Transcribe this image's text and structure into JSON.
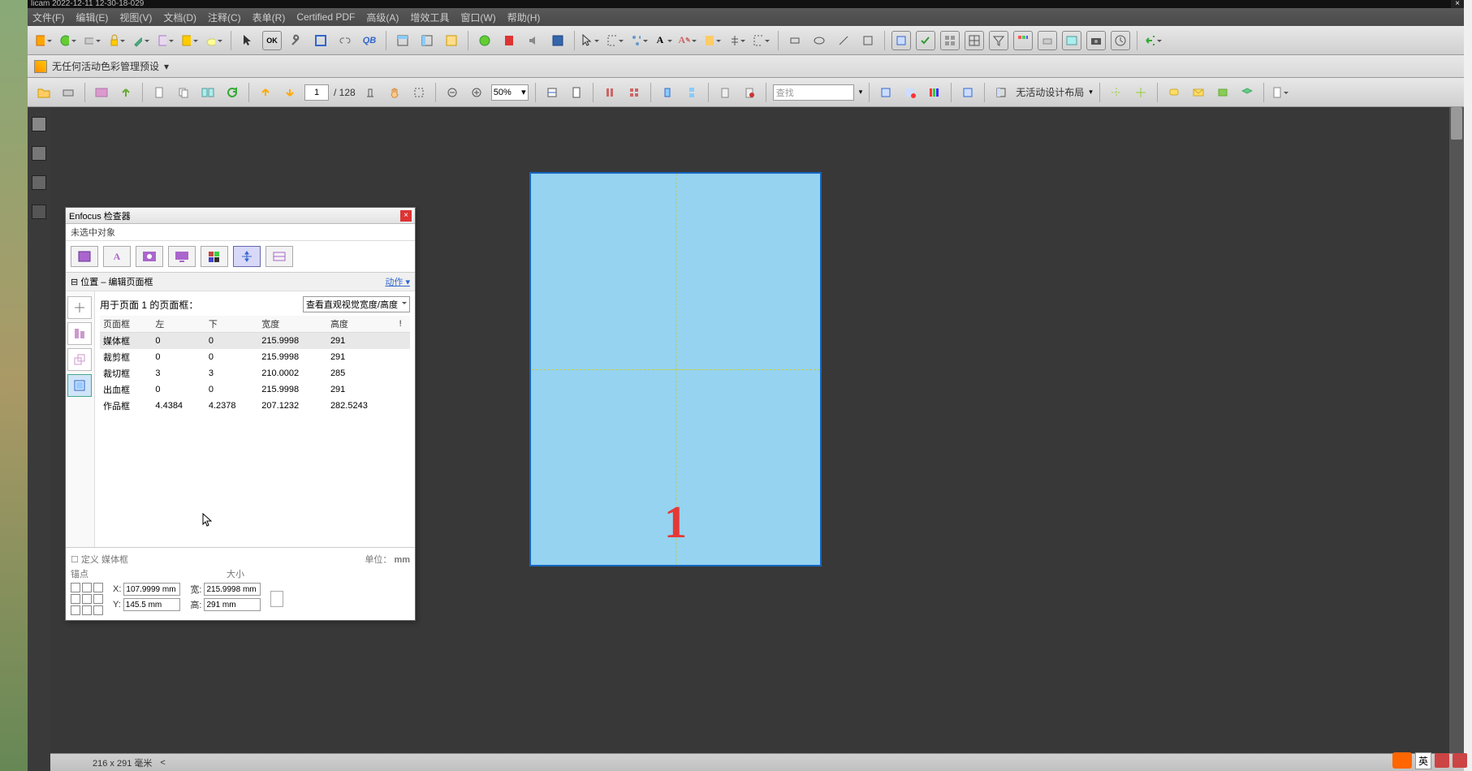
{
  "titlebar": {
    "text": "licam 2022-12-11 12-30-18-029"
  },
  "menu": [
    "文件(F)",
    "编辑(E)",
    "视图(V)",
    "文档(D)",
    "注释(C)",
    "表单(R)",
    "Certified PDF",
    "高级(A)",
    "增效工具",
    "窗口(W)",
    "帮助(H)"
  ],
  "color_preset": "无任何活动色彩管理预设",
  "toolbar2": {
    "page_current": "1",
    "page_total": "/ 128",
    "zoom": "50%",
    "search_placeholder": "查找",
    "layout_label": "无活动设计布局"
  },
  "statusbar": {
    "size": "216 x 291 毫米"
  },
  "page": {
    "number": "1"
  },
  "inspector": {
    "title": "Enfocus 检查器",
    "sub": "未选中对象",
    "section": "位置 – 编辑页面框",
    "action": "动作",
    "apply_label": "用于页面 1 的页面框：",
    "view_option": "查看直观视觉宽度/高度",
    "headers": [
      "页面框",
      "左",
      "下",
      "宽度",
      "高度",
      "!"
    ],
    "rows": [
      {
        "name": "媒体框",
        "l": "0",
        "b": "0",
        "w": "215.9998",
        "h": "291",
        "sel": true
      },
      {
        "name": "裁剪框",
        "l": "0",
        "b": "0",
        "w": "215.9998",
        "h": "291"
      },
      {
        "name": "裁切框",
        "l": "3",
        "b": "3",
        "w": "210.0002",
        "h": "285"
      },
      {
        "name": "出血框",
        "l": "0",
        "b": "0",
        "w": "215.9998",
        "h": "291"
      },
      {
        "name": "作品框",
        "l": "4.4384",
        "b": "4.2378",
        "w": "207.1232",
        "h": "282.5243"
      }
    ],
    "define": "定义 媒体框",
    "unit_label": "单位：",
    "unit": "mm",
    "anchor_label": "锚点",
    "size_label": "大小",
    "x_label": "X:",
    "y_label": "Y:",
    "w_label": "宽:",
    "h_label": "高:",
    "x": "107.9999 mm",
    "y": "145.5 mm",
    "w": "215.9998 mm",
    "h": "291 mm"
  },
  "tray": {
    "lang": "英"
  }
}
